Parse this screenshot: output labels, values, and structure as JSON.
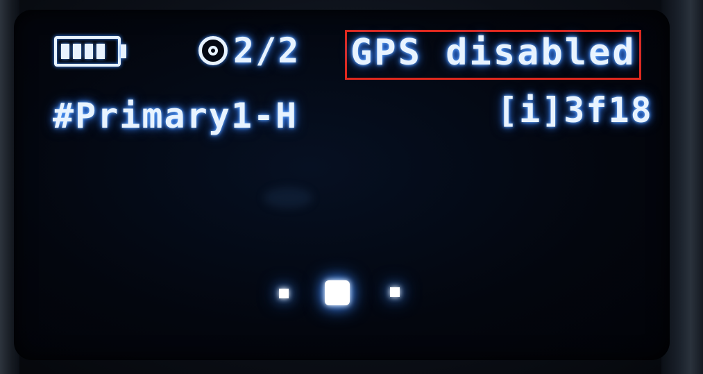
{
  "status_bar": {
    "battery_level": 1.0,
    "battery_segments_filled": 4,
    "satellites": "2/2",
    "gps_status": "GPS disabled"
  },
  "info_row": {
    "channel": "#Primary1-H",
    "node_id": "[i]3f18"
  },
  "pager": {
    "page_count": 3,
    "active_page": 2
  },
  "colors": {
    "oled_text": "#e8f3ff",
    "glow": "#2f7dff",
    "highlight_box": "#e0291e",
    "screen_bg": "#03060e"
  },
  "icons": {
    "battery": "battery-icon",
    "satellite": "satellite-icon"
  }
}
